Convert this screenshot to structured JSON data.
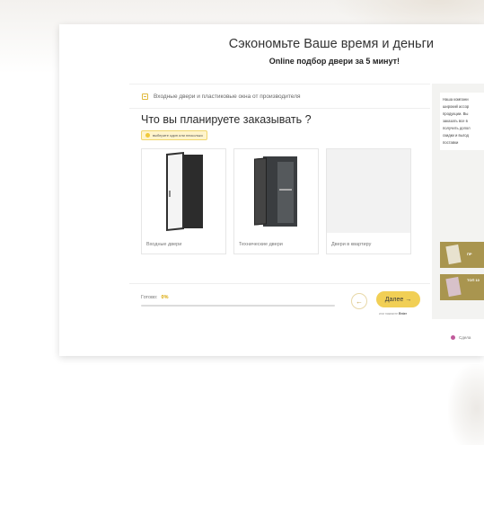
{
  "card": {
    "title": "Сэкономьте Ваше время и деньги",
    "subtitle": "Online подбор двери за 5 минут!"
  },
  "quiz": {
    "header_text": "Входные двери и пластиковые окна от производителя",
    "question": "Что вы планируете заказывать ?",
    "hint": "выберите один или несколько",
    "options": [
      {
        "label": "Входные двери",
        "image": "entrance-door"
      },
      {
        "label": "Технические двери",
        "image": "technical-door"
      },
      {
        "label": "Двери в квартиру",
        "image": "placeholder"
      }
    ],
    "footer": {
      "progress_label": "Готово:",
      "progress_value": "0%",
      "progress_fraction": 0,
      "back_icon": "←",
      "next_label": "Далее →",
      "enter_hint_prefix": "или нажмите",
      "enter_hint_key": "Enter"
    }
  },
  "sidebar": {
    "text_lines": [
      "Наша компани",
      "широкий ассор",
      "продукции. Вы",
      "заказать все в",
      "получить допол",
      "скидки и выгод",
      "поставки"
    ],
    "cards": [
      {
        "label": "ПР"
      },
      {
        "label": "ТОП 10"
      }
    ],
    "link_label": "Сдела"
  },
  "colors": {
    "accent": "#f1cf55",
    "accent_dark": "#e0b93d",
    "sidebar_card": "#a9954f"
  }
}
